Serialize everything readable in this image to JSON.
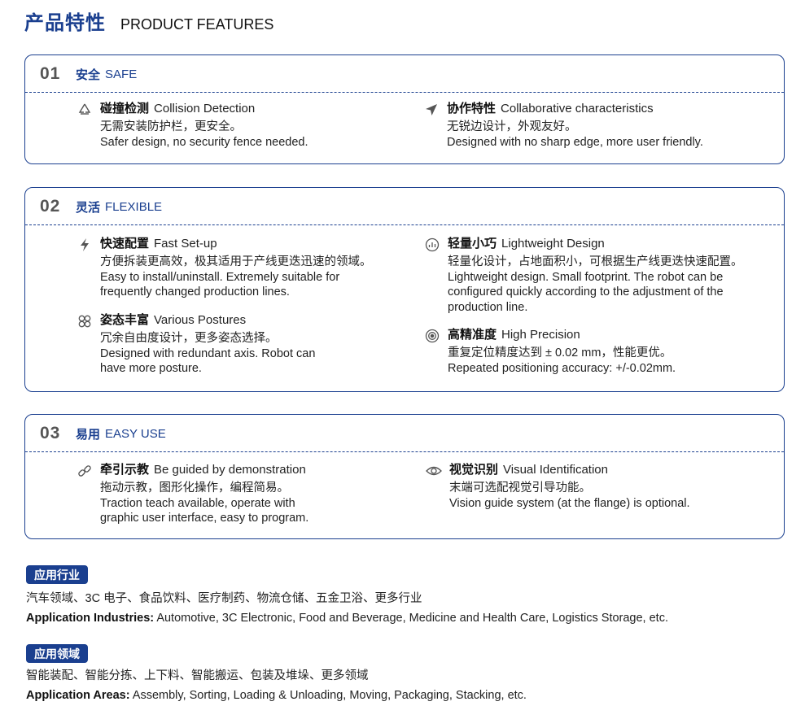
{
  "header": {
    "title_cn": "产品特性",
    "title_en": "PRODUCT FEATURES"
  },
  "sections": [
    {
      "num": "01",
      "title_cn": "安全",
      "title_en": "SAFE",
      "features": [
        {
          "icon": "recycle-icon",
          "title_cn": "碰撞检测",
          "title_en": "Collision Detection",
          "lines": [
            "无需安装防护栏，更安全。",
            "Safer design, no security fence needed."
          ]
        },
        {
          "icon": "arrow-pointer-icon",
          "title_cn": "协作特性",
          "title_en": "Collaborative characteristics",
          "lines": [
            "无锐边设计，外观友好。",
            "Designed with no sharp edge, more user friendly."
          ]
        }
      ]
    },
    {
      "num": "02",
      "title_cn": "灵活",
      "title_en": "FLEXIBLE",
      "features": [
        {
          "icon": "lightning-icon",
          "title_cn": "快速配置",
          "title_en": "Fast Set-up",
          "lines": [
            "方便拆装更高效，极其适用于产线更迭迅速的领域。",
            "Easy to install/uninstall. Extremely suitable for",
            "frequently changed production lines."
          ]
        },
        {
          "icon": "scale-gauge-icon",
          "title_cn": "轻量小巧",
          "title_en": "Lightweight Design",
          "lines": [
            "轻量化设计，占地面积小，可根据生产线更迭快速配置。",
            "Lightweight design. Small footprint. The robot can be",
            "configured quickly according to the adjustment of the",
            "production line."
          ]
        },
        {
          "icon": "clover-icon",
          "title_cn": "姿态丰富",
          "title_en": "Various Postures",
          "lines": [
            "冗余自由度设计，更多姿态选择。",
            "Designed with redundant axis. Robot can",
            "have more posture."
          ]
        },
        {
          "icon": "target-icon",
          "title_cn": "高精准度",
          "title_en": "High Precision",
          "lines": [
            "重复定位精度达到 ± 0.02 mm，性能更优。",
            "Repeated positioning accuracy: +/-0.02mm."
          ]
        }
      ]
    },
    {
      "num": "03",
      "title_cn": "易用",
      "title_en": "EASY USE",
      "features": [
        {
          "icon": "link-icon",
          "title_cn": "牵引示教",
          "title_en": "Be guided by demonstration",
          "lines": [
            "拖动示教，图形化操作，编程简易。",
            "Traction teach available, operate with",
            "graphic user interface, easy to program."
          ]
        },
        {
          "icon": "eye-icon",
          "title_cn": "视觉识别",
          "title_en": "Visual Identification",
          "lines": [
            "末端可选配视觉引导功能。",
            "Vision guide system (at the flange) is optional."
          ]
        }
      ]
    }
  ],
  "industries": {
    "badge": "应用行业",
    "cn": "汽车领域、3C 电子、食品饮料、医疗制药、物流仓储、五金卫浴、更多行业",
    "en_label": "Application Industries:",
    "en_text": " Automotive, 3C Electronic, Food and Beverage, Medicine and Health Care, Logistics Storage, etc."
  },
  "areas": {
    "badge": "应用领域",
    "cn": "智能装配、智能分拣、上下料、智能搬运、包装及堆垛、更多领域",
    "en_label": "Application Areas:",
    "en_text": " Assembly, Sorting, Loading & Unloading, Moving, Packaging, Stacking, etc."
  }
}
